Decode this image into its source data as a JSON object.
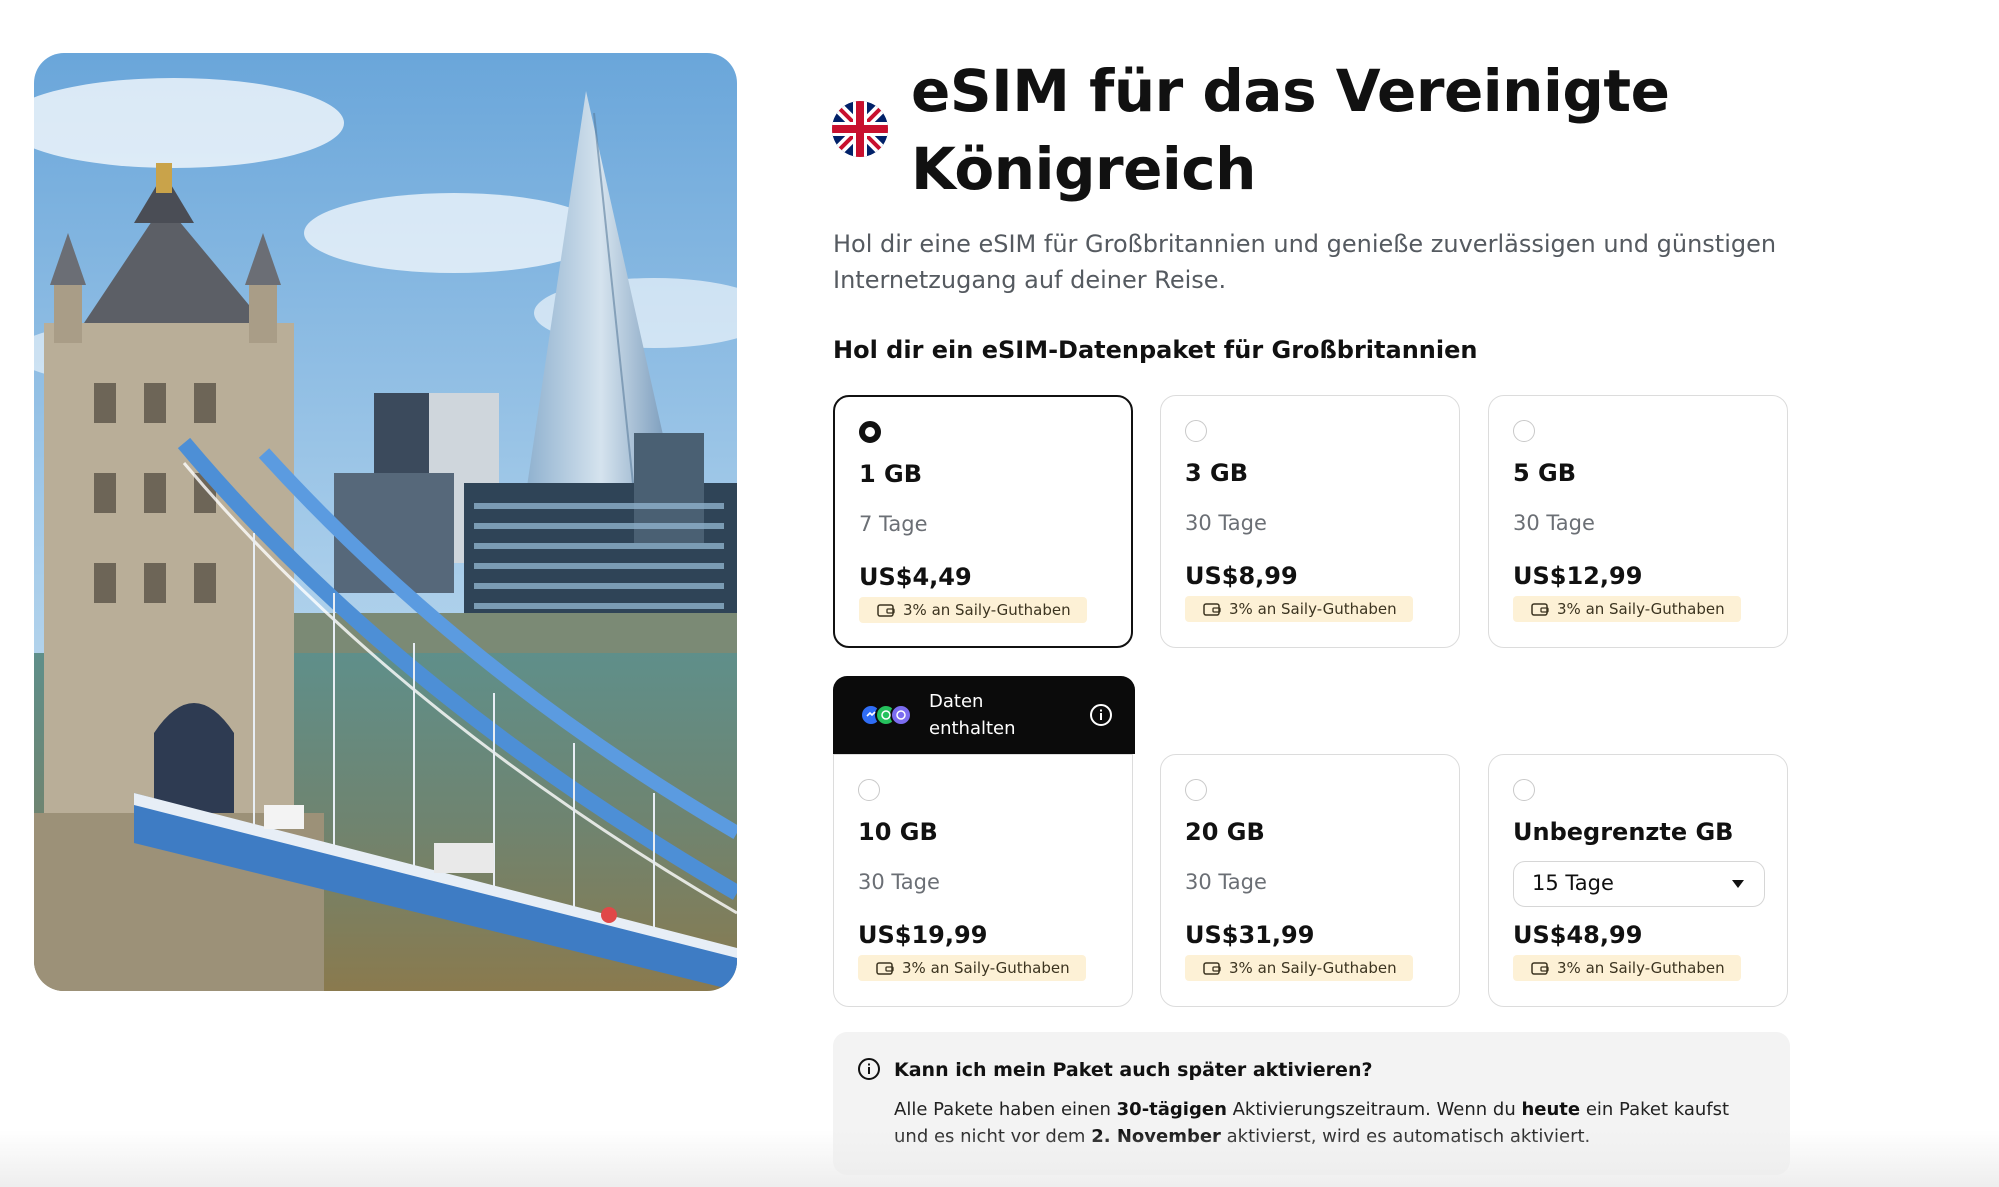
{
  "hero": {
    "image_name": "tower-bridge-london-photo"
  },
  "flag": {
    "icon": "uk-flag-icon"
  },
  "header": {
    "title": "eSIM für das Vereinigte Königreich",
    "subtitle": "Hol dir eine eSIM für Großbritannien und genieße zuverlässigen und günstigen Internetzugang auf deiner Reise."
  },
  "plans": {
    "heading": "Hol dir ein eSIM-Datenpaket für Großbritannien",
    "cashback_label": "3% an Saily-Guthaben",
    "items": [
      {
        "data": "1 GB",
        "duration": "7 Tage",
        "price": "US$4,49",
        "selected": true
      },
      {
        "data": "3 GB",
        "duration": "30 Tage",
        "price": "US$8,99",
        "selected": false
      },
      {
        "data": "5 GB",
        "duration": "30 Tage",
        "price": "US$12,99",
        "selected": false
      },
      {
        "data": "10 GB",
        "duration": "30 Tage",
        "price": "US$19,99",
        "selected": false
      },
      {
        "data": "20 GB",
        "duration": "30 Tage",
        "price": "US$31,99",
        "selected": false
      },
      {
        "data": "Unbegrenzte GB",
        "duration_select": "15 Tage",
        "price": "US$48,99",
        "selected": false
      }
    ],
    "banner": {
      "text_line1": "Daten",
      "text_line2": "enthalten"
    }
  },
  "faq": {
    "question": "Kann ich mein Paket auch später aktivieren?",
    "answer": {
      "p1": "Alle Pakete haben einen ",
      "b1": "30-tägigen",
      "p2": " Aktivierungszeitraum. Wenn du ",
      "b2": "heute",
      "p3": " ein Paket kaufst und es nicht vor dem ",
      "b3": "2. November",
      "p4": " aktivierst, wird es automatisch aktiviert."
    }
  },
  "colors": {
    "text": "#111111",
    "muted": "#6b6f75",
    "card_border": "#dcdcdc",
    "cashback_bg": "#fdf1d6",
    "banner_bg": "#0b0b0b",
    "faq_bg": "#f3f3f3"
  }
}
